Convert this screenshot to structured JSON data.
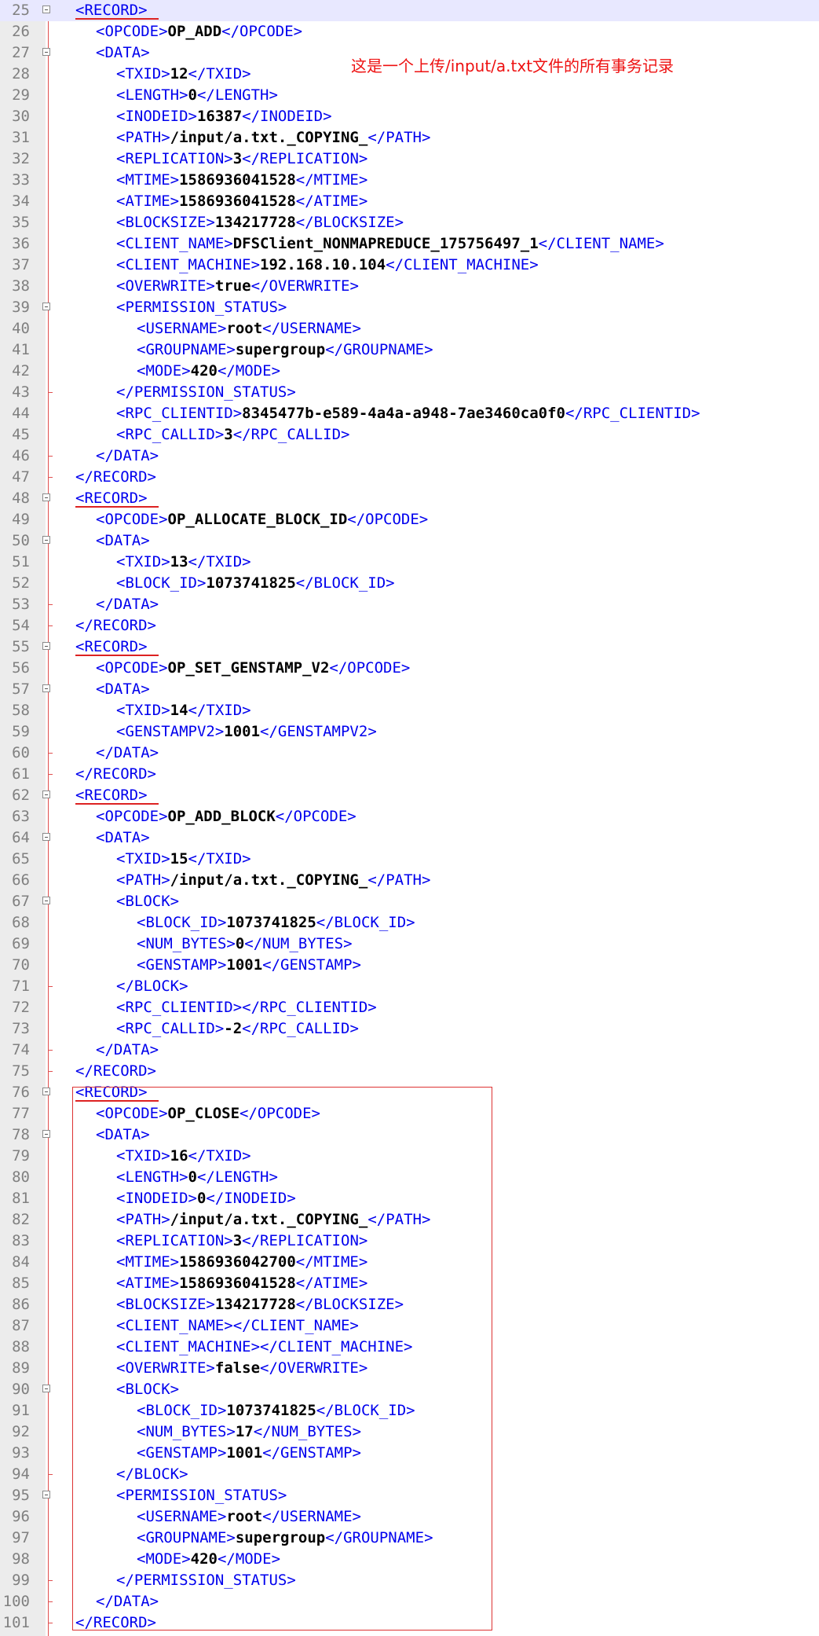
{
  "editor": {
    "annotation": "这是一个上传/input/a.txt文件的所有事务记录",
    "colors": {
      "tag": "#0000ee",
      "value": "#000000",
      "line_number": "#808080",
      "gutter": "#ececec",
      "annotation": "#ee1111",
      "highlight_box": "#dd3333",
      "current_line": "#e8e8ff"
    },
    "icons": [
      "fold-toggle-icon"
    ],
    "lines": [
      {
        "n": "25",
        "indent": 0,
        "o": "<RECORD>",
        "fold": true
      },
      {
        "n": "26",
        "indent": 1,
        "o": "<OPCODE>",
        "v": "OP_ADD",
        "c": "</OPCODE>"
      },
      {
        "n": "27",
        "indent": 1,
        "o": "<DATA>",
        "fold": true
      },
      {
        "n": "28",
        "indent": 2,
        "o": "<TXID>",
        "v": "12",
        "c": "</TXID>"
      },
      {
        "n": "29",
        "indent": 2,
        "o": "<LENGTH>",
        "v": "0",
        "c": "</LENGTH>"
      },
      {
        "n": "30",
        "indent": 2,
        "o": "<INODEID>",
        "v": "16387",
        "c": "</INODEID>"
      },
      {
        "n": "31",
        "indent": 2,
        "o": "<PATH>",
        "v": "/input/a.txt._COPYING_",
        "c": "</PATH>"
      },
      {
        "n": "32",
        "indent": 2,
        "o": "<REPLICATION>",
        "v": "3",
        "c": "</REPLICATION>"
      },
      {
        "n": "33",
        "indent": 2,
        "o": "<MTIME>",
        "v": "1586936041528",
        "c": "</MTIME>"
      },
      {
        "n": "34",
        "indent": 2,
        "o": "<ATIME>",
        "v": "1586936041528",
        "c": "</ATIME>"
      },
      {
        "n": "35",
        "indent": 2,
        "o": "<BLOCKSIZE>",
        "v": "134217728",
        "c": "</BLOCKSIZE>"
      },
      {
        "n": "36",
        "indent": 2,
        "o": "<CLIENT_NAME>",
        "v": "DFSClient_NONMAPREDUCE_175756497_1",
        "c": "</CLIENT_NAME>"
      },
      {
        "n": "37",
        "indent": 2,
        "o": "<CLIENT_MACHINE>",
        "v": "192.168.10.104",
        "c": "</CLIENT_MACHINE>"
      },
      {
        "n": "38",
        "indent": 2,
        "o": "<OVERWRITE>",
        "v": "true",
        "c": "</OVERWRITE>"
      },
      {
        "n": "39",
        "indent": 2,
        "o": "<PERMISSION_STATUS>",
        "fold": true
      },
      {
        "n": "40",
        "indent": 3,
        "o": "<USERNAME>",
        "v": "root",
        "c": "</USERNAME>"
      },
      {
        "n": "41",
        "indent": 3,
        "o": "<GROUPNAME>",
        "v": "supergroup",
        "c": "</GROUPNAME>"
      },
      {
        "n": "42",
        "indent": 3,
        "o": "<MODE>",
        "v": "420",
        "c": "</MODE>"
      },
      {
        "n": "43",
        "indent": 2,
        "o": "</PERMISSION_STATUS>",
        "end": true
      },
      {
        "n": "44",
        "indent": 2,
        "o": "<RPC_CLIENTID>",
        "v": "8345477b-e589-4a4a-a948-7ae3460ca0f0",
        "c": "</RPC_CLIENTID>"
      },
      {
        "n": "45",
        "indent": 2,
        "o": "<RPC_CALLID>",
        "v": "3",
        "c": "</RPC_CALLID>"
      },
      {
        "n": "46",
        "indent": 1,
        "o": "</DATA>",
        "end": true
      },
      {
        "n": "47",
        "indent": 0,
        "o": "</RECORD>",
        "end": true
      },
      {
        "n": "48",
        "indent": 0,
        "o": "<RECORD>",
        "fold": true
      },
      {
        "n": "49",
        "indent": 1,
        "o": "<OPCODE>",
        "v": "OP_ALLOCATE_BLOCK_ID",
        "c": "</OPCODE>"
      },
      {
        "n": "50",
        "indent": 1,
        "o": "<DATA>",
        "fold": true
      },
      {
        "n": "51",
        "indent": 2,
        "o": "<TXID>",
        "v": "13",
        "c": "</TXID>"
      },
      {
        "n": "52",
        "indent": 2,
        "o": "<BLOCK_ID>",
        "v": "1073741825",
        "c": "</BLOCK_ID>"
      },
      {
        "n": "53",
        "indent": 1,
        "o": "</DATA>",
        "end": true
      },
      {
        "n": "54",
        "indent": 0,
        "o": "</RECORD>",
        "end": true
      },
      {
        "n": "55",
        "indent": 0,
        "o": "<RECORD>",
        "fold": true
      },
      {
        "n": "56",
        "indent": 1,
        "o": "<OPCODE>",
        "v": "OP_SET_GENSTAMP_V2",
        "c": "</OPCODE>"
      },
      {
        "n": "57",
        "indent": 1,
        "o": "<DATA>",
        "fold": true
      },
      {
        "n": "58",
        "indent": 2,
        "o": "<TXID>",
        "v": "14",
        "c": "</TXID>"
      },
      {
        "n": "59",
        "indent": 2,
        "o": "<GENSTAMPV2>",
        "v": "1001",
        "c": "</GENSTAMPV2>"
      },
      {
        "n": "60",
        "indent": 1,
        "o": "</DATA>",
        "end": true
      },
      {
        "n": "61",
        "indent": 0,
        "o": "</RECORD>",
        "end": true
      },
      {
        "n": "62",
        "indent": 0,
        "o": "<RECORD>",
        "fold": true
      },
      {
        "n": "63",
        "indent": 1,
        "o": "<OPCODE>",
        "v": "OP_ADD_BLOCK",
        "c": "</OPCODE>"
      },
      {
        "n": "64",
        "indent": 1,
        "o": "<DATA>",
        "fold": true
      },
      {
        "n": "65",
        "indent": 2,
        "o": "<TXID>",
        "v": "15",
        "c": "</TXID>"
      },
      {
        "n": "66",
        "indent": 2,
        "o": "<PATH>",
        "v": "/input/a.txt._COPYING_",
        "c": "</PATH>"
      },
      {
        "n": "67",
        "indent": 2,
        "o": "<BLOCK>",
        "fold": true
      },
      {
        "n": "68",
        "indent": 3,
        "o": "<BLOCK_ID>",
        "v": "1073741825",
        "c": "</BLOCK_ID>"
      },
      {
        "n": "69",
        "indent": 3,
        "o": "<NUM_BYTES>",
        "v": "0",
        "c": "</NUM_BYTES>"
      },
      {
        "n": "70",
        "indent": 3,
        "o": "<GENSTAMP>",
        "v": "1001",
        "c": "</GENSTAMP>"
      },
      {
        "n": "71",
        "indent": 2,
        "o": "</BLOCK>",
        "end": true
      },
      {
        "n": "72",
        "indent": 2,
        "o": "<RPC_CLIENTID>",
        "v": "",
        "c": "</RPC_CLIENTID>"
      },
      {
        "n": "73",
        "indent": 2,
        "o": "<RPC_CALLID>",
        "v": "-2",
        "c": "</RPC_CALLID>"
      },
      {
        "n": "74",
        "indent": 1,
        "o": "</DATA>",
        "end": true
      },
      {
        "n": "75",
        "indent": 0,
        "o": "</RECORD>",
        "end": true
      },
      {
        "n": "76",
        "indent": 0,
        "o": "<RECORD>",
        "fold": true
      },
      {
        "n": "77",
        "indent": 1,
        "o": "<OPCODE>",
        "v": "OP_CLOSE",
        "c": "</OPCODE>"
      },
      {
        "n": "78",
        "indent": 1,
        "o": "<DATA>",
        "fold": true
      },
      {
        "n": "79",
        "indent": 2,
        "o": "<TXID>",
        "v": "16",
        "c": "</TXID>"
      },
      {
        "n": "80",
        "indent": 2,
        "o": "<LENGTH>",
        "v": "0",
        "c": "</LENGTH>"
      },
      {
        "n": "81",
        "indent": 2,
        "o": "<INODEID>",
        "v": "0",
        "c": "</INODEID>"
      },
      {
        "n": "82",
        "indent": 2,
        "o": "<PATH>",
        "v": "/input/a.txt._COPYING_",
        "c": "</PATH>"
      },
      {
        "n": "83",
        "indent": 2,
        "o": "<REPLICATION>",
        "v": "3",
        "c": "</REPLICATION>"
      },
      {
        "n": "84",
        "indent": 2,
        "o": "<MTIME>",
        "v": "1586936042700",
        "c": "</MTIME>"
      },
      {
        "n": "85",
        "indent": 2,
        "o": "<ATIME>",
        "v": "1586936041528",
        "c": "</ATIME>"
      },
      {
        "n": "86",
        "indent": 2,
        "o": "<BLOCKSIZE>",
        "v": "134217728",
        "c": "</BLOCKSIZE>"
      },
      {
        "n": "87",
        "indent": 2,
        "o": "<CLIENT_NAME>",
        "v": "",
        "c": "</CLIENT_NAME>"
      },
      {
        "n": "88",
        "indent": 2,
        "o": "<CLIENT_MACHINE>",
        "v": "",
        "c": "</CLIENT_MACHINE>"
      },
      {
        "n": "89",
        "indent": 2,
        "o": "<OVERWRITE>",
        "v": "false",
        "c": "</OVERWRITE>"
      },
      {
        "n": "90",
        "indent": 2,
        "o": "<BLOCK>",
        "fold": true
      },
      {
        "n": "91",
        "indent": 3,
        "o": "<BLOCK_ID>",
        "v": "1073741825",
        "c": "</BLOCK_ID>"
      },
      {
        "n": "92",
        "indent": 3,
        "o": "<NUM_BYTES>",
        "v": "17",
        "c": "</NUM_BYTES>"
      },
      {
        "n": "93",
        "indent": 3,
        "o": "<GENSTAMP>",
        "v": "1001",
        "c": "</GENSTAMP>"
      },
      {
        "n": "94",
        "indent": 2,
        "o": "</BLOCK>",
        "end": true
      },
      {
        "n": "95",
        "indent": 2,
        "o": "<PERMISSION_STATUS>",
        "fold": true
      },
      {
        "n": "96",
        "indent": 3,
        "o": "<USERNAME>",
        "v": "root",
        "c": "</USERNAME>"
      },
      {
        "n": "97",
        "indent": 3,
        "o": "<GROUPNAME>",
        "v": "supergroup",
        "c": "</GROUPNAME>"
      },
      {
        "n": "98",
        "indent": 3,
        "o": "<MODE>",
        "v": "420",
        "c": "</MODE>"
      },
      {
        "n": "99",
        "indent": 2,
        "o": "</PERMISSION_STATUS>",
        "end": true
      },
      {
        "n": "100",
        "indent": 1,
        "o": "</DATA>",
        "end": true
      },
      {
        "n": "101",
        "indent": 0,
        "o": "</RECORD>",
        "end": true
      }
    ]
  }
}
